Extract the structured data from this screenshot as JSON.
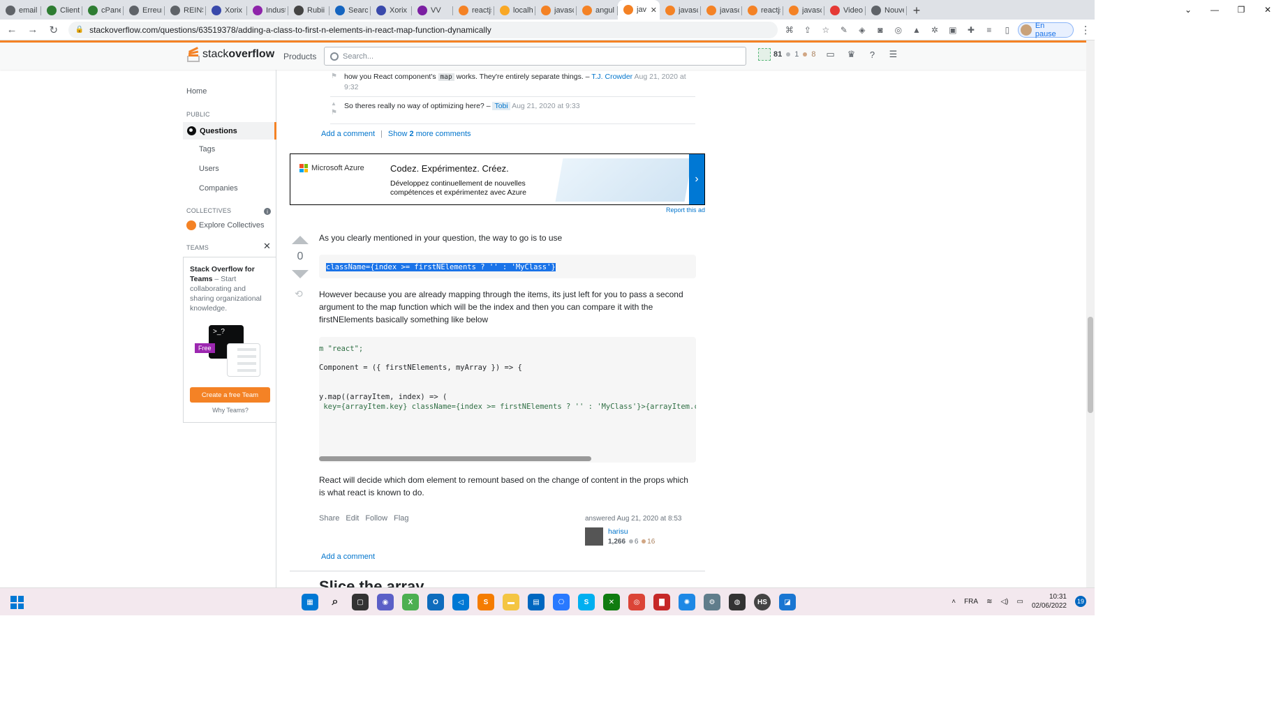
{
  "browser": {
    "tabs": [
      {
        "title": "email",
        "color": "#5f6368"
      },
      {
        "title": "Client",
        "color": "#2e7d32"
      },
      {
        "title": "cPanel",
        "color": "#2e7d32"
      },
      {
        "title": "Erreur",
        "color": "#5f6368"
      },
      {
        "title": "REINS",
        "color": "#5f6368"
      },
      {
        "title": "Xorix",
        "color": "#3949ab"
      },
      {
        "title": "Indust",
        "color": "#8e24aa"
      },
      {
        "title": "Rubii",
        "color": "#444"
      },
      {
        "title": "Search",
        "color": "#1565c0"
      },
      {
        "title": "Xorix",
        "color": "#3949ab"
      },
      {
        "title": "VV",
        "color": "#7b1fa2"
      },
      {
        "title": "reactjs",
        "color": "#f48225"
      },
      {
        "title": "localh",
        "color": "#f9a825"
      },
      {
        "title": "javasc",
        "color": "#f48225"
      },
      {
        "title": "angul",
        "color": "#f48225"
      },
      {
        "title": "jav",
        "color": "#f48225",
        "active": true
      },
      {
        "title": "javasc",
        "color": "#f48225"
      },
      {
        "title": "javasc",
        "color": "#f48225"
      },
      {
        "title": "reactjs",
        "color": "#f48225"
      },
      {
        "title": "javasc",
        "color": "#f48225"
      },
      {
        "title": "Video",
        "color": "#e53935"
      },
      {
        "title": "Nouve",
        "color": "#5f6368"
      }
    ],
    "url": "stackoverflow.com/questions/63519378/adding-a-class-to-first-n-elements-in-react-map-function-dynamically",
    "profile_label": "En pause"
  },
  "so": {
    "logo_light": "stack",
    "logo_bold": "overflow",
    "products": "Products",
    "search_placeholder": "Search...",
    "reputation": "81",
    "silver": "1",
    "bronze": "8"
  },
  "sidebar": {
    "home": "Home",
    "public": "PUBLIC",
    "questions": "Questions",
    "tags": "Tags",
    "users": "Users",
    "companies": "Companies",
    "collectives": "COLLECTIVES",
    "explore": "Explore Collectives",
    "teams": "TEAMS",
    "teams_title": "Stack Overflow for Teams",
    "teams_text": " – Start collaborating and sharing organizational knowledge.",
    "free": "Free",
    "cta": "Create a free Team",
    "why": "Why Teams?"
  },
  "comments": {
    "c1_text": "how you React component's",
    "c1_code": "map",
    "c1_text2": "works. They're entirely separate things. –",
    "c1_user": "T.J. Crowder",
    "c1_time": "Aug 21, 2020 at",
    "c1_time2": "9:32",
    "c2_text": "So theres really no way of optimizing here? –",
    "c2_user": "Tobi",
    "c2_time": "Aug 21, 2020 at 9:33",
    "add_comment": "Add a comment",
    "show_more": "Show",
    "show_count": "2",
    "show_more2": "more comments"
  },
  "ad": {
    "brand": "Microsoft Azure",
    "headline": "Codez. Expérimentez. Créez.",
    "body": "Développez continuellement de nouvelles compétences et expérimentez avec Azure",
    "report": "Report this ad"
  },
  "answer": {
    "score": "0",
    "p1": "As you clearly mentioned in your question, the way to go is to use",
    "inline_code": "className={index >= firstNElements ? '' : 'MyClass'}",
    "p2": "However because you are already mapping through the items, its just left for you to pass a second argument to the map function which will be the index and then you can compare it with the firstNElements basically something like below",
    "code_lines": [
      "m \"react\";",
      "Component = ({ firstNElements, myArray }) => {",
      "y.map((arrayItem, index) => (",
      " key={arrayItem.key} className={index >= firstNElements ? '' : 'MyClass'}>{arrayItem.c"
    ],
    "p3": "React will decide which dom element to remount based on the change of content in the props which is what react is known to do.",
    "menu": [
      "Share",
      "Edit",
      "Follow",
      "Flag"
    ],
    "answered": "answered Aug 21, 2020 at 8:53",
    "user": "harisu",
    "user_rep": "1,266",
    "user_silver": "6",
    "user_bronze": "16",
    "add_comment": "Add a comment",
    "next_heading": "Slice the array"
  },
  "taskbar": {
    "lang": "FRA",
    "time": "10:31",
    "date": "02/06/2022",
    "badge": "19"
  }
}
